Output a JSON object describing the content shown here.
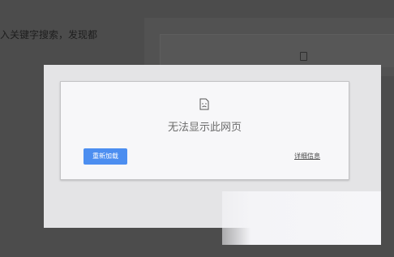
{
  "background": {
    "partial_text": "入关键字搜索，发现都"
  },
  "error_page": {
    "title": "无法显示此网页",
    "reload_label": "重新加载",
    "details_label": "详细信息",
    "icon": "sad-page-icon",
    "accent_color": "#4c8ef0"
  }
}
